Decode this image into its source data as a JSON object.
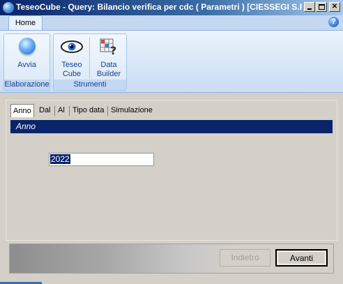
{
  "window": {
    "title": "TeseoCube - Query: Bilancio verifica per cdc ( Parametri ) [CIESSEGI S.R....",
    "controls": {
      "minimize": "",
      "maximize": "",
      "close": "✕"
    },
    "help": "?"
  },
  "ribbon": {
    "tab": "Home",
    "groups": [
      {
        "label": "Elaborazione",
        "buttons": [
          {
            "label": "Avvia",
            "icon": "play-orb-icon"
          }
        ]
      },
      {
        "label": "Strumenti",
        "buttons": [
          {
            "label": "Teseo\nCube",
            "icon": "eye-icon"
          },
          {
            "label": "Data\nBuilder",
            "icon": "data-builder-icon"
          }
        ]
      }
    ]
  },
  "wizard": {
    "tabs": [
      "Anno",
      "Dal",
      "Al",
      "Tipo data",
      "Simulazione"
    ],
    "active_tab": "Anno",
    "section_title": "Anno",
    "year_value": "2022"
  },
  "footer": {
    "back_label": "Indietro",
    "next_label": "Avanti"
  },
  "colors": {
    "title_bar": "#0a246a",
    "section_header": "#0a246a",
    "ribbon": "#d6e6f8",
    "ribbon_text": "#15428b",
    "window_bg": "#d4d0c8"
  }
}
